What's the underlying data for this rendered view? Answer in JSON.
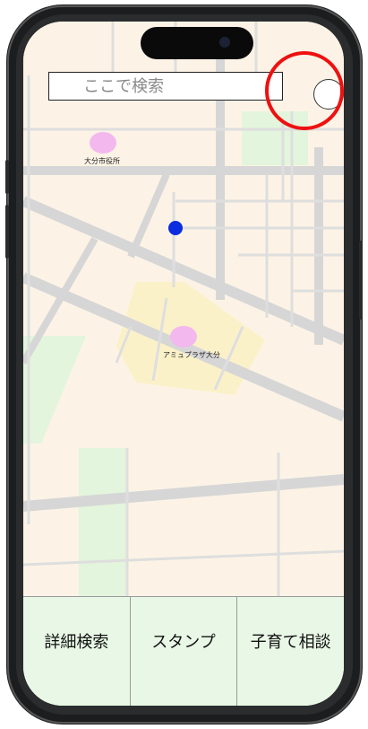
{
  "search": {
    "placeholder": "ここで検索",
    "value": ""
  },
  "map": {
    "markers": [
      {
        "label": "大分市役所",
        "color": "#f3b8ee"
      },
      {
        "label": "アミュプラザ大分",
        "color": "#f3b8ee"
      }
    ],
    "current_location_color": "#0a2de0"
  },
  "bottom_nav": {
    "items": [
      {
        "label": "詳細検索"
      },
      {
        "label": "スタンプ"
      },
      {
        "label": "子育て相談"
      }
    ]
  },
  "colors": {
    "map_background": "#fcf3e6",
    "road": "#d9d9d9",
    "park": "#e3f5dc",
    "station_area": "#fbf1c9",
    "highlight_ring": "#ee1111",
    "bottom_bar": "#e9f8e6"
  },
  "icons": {
    "location_button": "circle-button-icon",
    "current_location": "current-location-dot-icon"
  }
}
